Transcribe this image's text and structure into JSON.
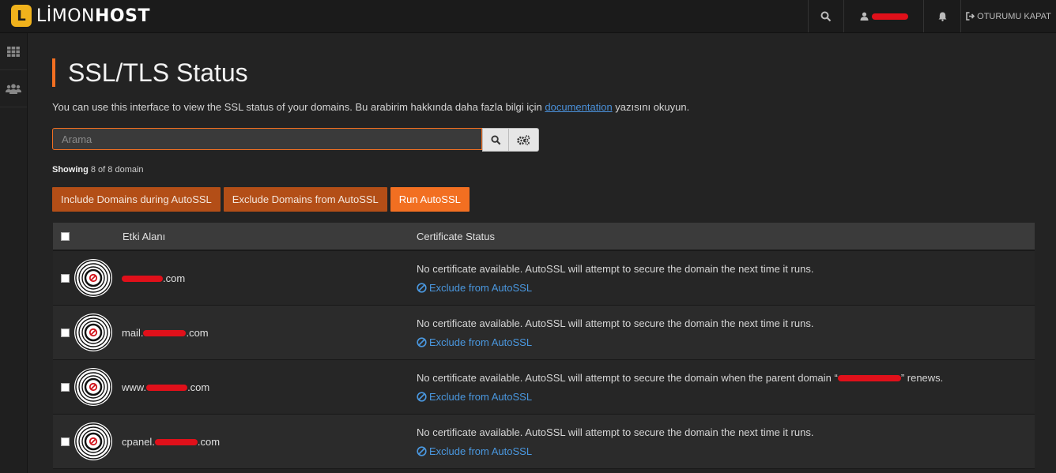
{
  "header": {
    "logo_mark": "L",
    "logo_prefix": "LİMON",
    "logo_suffix": "HOST",
    "logout_label": "OTURUMU KAPAT"
  },
  "page": {
    "title": "SSL/TLS Status",
    "description_before": "You can use this interface to view the SSL status of your domains. Bu arabirim hakkında daha fazla bilgi için ",
    "description_link": "documentation",
    "description_after": " yazısını okuyun."
  },
  "search": {
    "placeholder": "Arama"
  },
  "showing": {
    "label": "Showing",
    "text": " 8 of 8 domain"
  },
  "actions": {
    "include": "Include Domains during AutoSSL",
    "exclude": "Exclude Domains from AutoSSL",
    "run": "Run AutoSSL"
  },
  "table": {
    "headers": {
      "domain": "Etki Alanı",
      "status": "Certificate Status"
    },
    "exclude_link": "Exclude from AutoSSL",
    "rows": [
      {
        "prefix": "",
        "suffix": ".com",
        "status_before": "No certificate available. AutoSSL will attempt to secure the domain the next time it runs.",
        "status_after": ""
      },
      {
        "prefix": "mail.",
        "suffix": ".com",
        "status_before": "No certificate available. AutoSSL will attempt to secure the domain the next time it runs.",
        "status_after": ""
      },
      {
        "prefix": "www.",
        "suffix": ".com",
        "status_before": "No certificate available. AutoSSL will attempt to secure the domain when the parent domain “",
        "status_after": "” renews."
      },
      {
        "prefix": "cpanel.",
        "suffix": ".com",
        "status_before": "No certificate available. AutoSSL will attempt to secure the domain the next time it runs.",
        "status_after": ""
      }
    ]
  },
  "colors": {
    "accent": "#f26f21",
    "link": "#4a98e0",
    "redaction": "#e0101a"
  },
  "icons": [
    "search-icon",
    "user-icon",
    "bell-icon",
    "logout-icon",
    "grid-icon",
    "users-icon",
    "gears-icon",
    "ssl-seal-icon",
    "ban-icon"
  ]
}
